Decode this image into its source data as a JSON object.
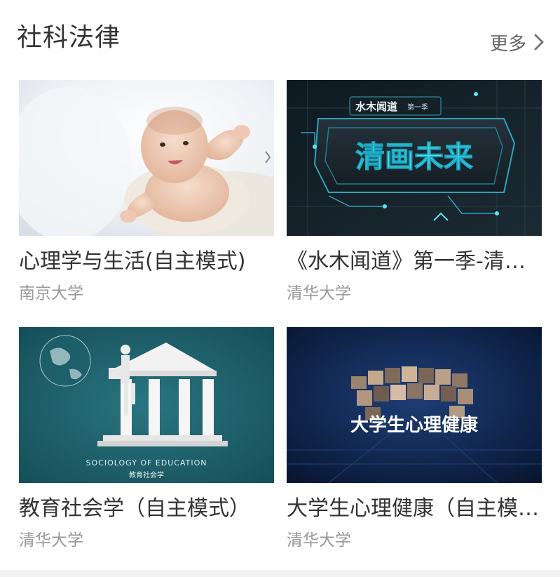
{
  "section": {
    "title": "社科法律",
    "more_label": "更多"
  },
  "courses": [
    {
      "title": "心理学与生活(自主模式)",
      "school": "南京大学",
      "thumbnail": "baby-photo"
    },
    {
      "title": "《水木闻道》第一季-清华讲堂",
      "school": "清华大学",
      "thumbnail": "tech-banner",
      "thumb_top_text": "水木闻道",
      "thumb_top_sub": "第一季",
      "thumb_main_text": "清画未来"
    },
    {
      "title": "教育社会学（自主模式）",
      "school": "清华大学",
      "thumbnail": "education-temple",
      "thumb_caption_en": "SOCIOLOGY OF EDUCATION",
      "thumb_caption_cn": "教育社会学"
    },
    {
      "title": "大学生心理健康（自主模式）",
      "school": "清华大学",
      "thumbnail": "photo-wall",
      "thumb_main_text": "大学生心理健康"
    }
  ]
}
